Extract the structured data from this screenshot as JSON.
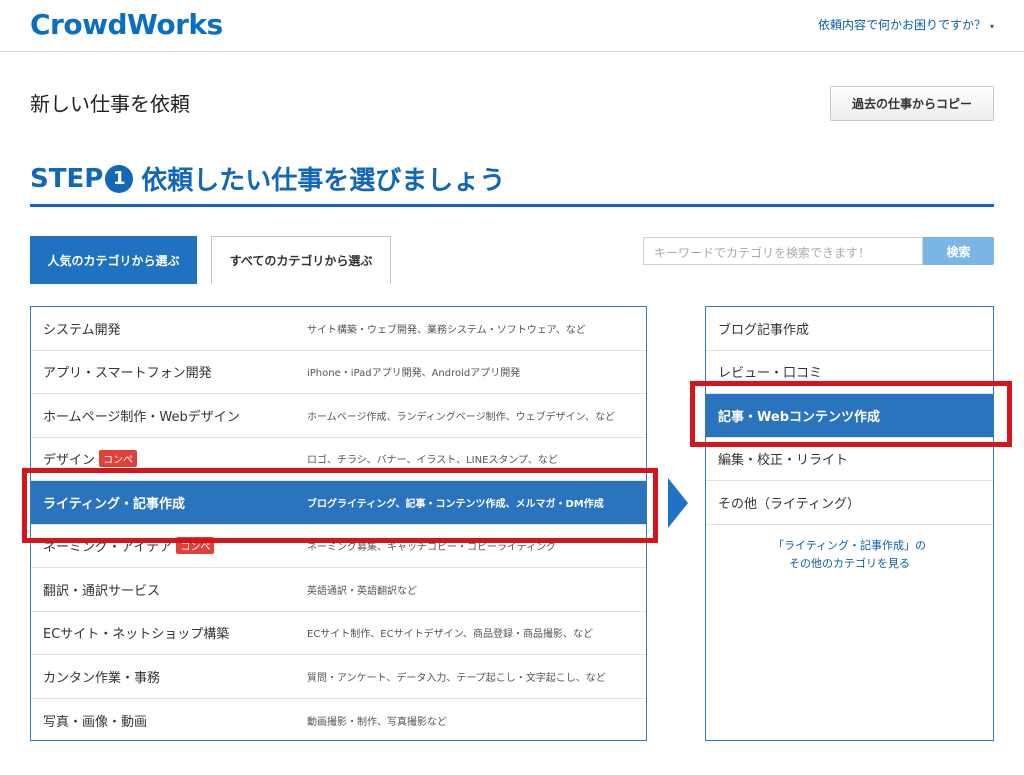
{
  "header": {
    "logo": "CrowdWorks",
    "help_link": "依頼内容で何かお困りですか？",
    "help_caret": "▾"
  },
  "page": {
    "title": "新しい仕事を依頼",
    "copy_button": "過去の仕事からコピー"
  },
  "step": {
    "prefix": "STEP",
    "number": "1",
    "title": "依頼したい仕事を選びましょう"
  },
  "tabs": {
    "popular": "人気のカテゴリから選ぶ",
    "all": "すべてのカテゴリから選ぶ"
  },
  "search": {
    "placeholder": "キーワードでカテゴリを検索できます！",
    "button": "検索"
  },
  "categories": [
    {
      "name": "システム開発",
      "desc": "サイト構築・ウェブ開発、業務システム・ソフトウェア、など",
      "badge": ""
    },
    {
      "name": "アプリ・スマートフォン開発",
      "desc": "iPhone・iPadアプリ開発、Androidアプリ開発",
      "badge": ""
    },
    {
      "name": "ホームページ制作・Webデザイン",
      "desc": "ホームページ作成、ランディングページ制作、ウェブデザイン、など",
      "badge": ""
    },
    {
      "name": "デザイン",
      "desc": "ロゴ、チラシ、バナー、イラスト、LINEスタンプ、など",
      "badge": "コンペ"
    },
    {
      "name": "ライティング・記事作成",
      "desc": "ブログライティング、記事・コンテンツ作成、メルマガ・DM作成",
      "badge": ""
    },
    {
      "name": "ネーミング・アイデア",
      "desc": "ネーミング募集、キャッチコピー・コピーライティング",
      "badge": "コンペ"
    },
    {
      "name": "翻訳・通訳サービス",
      "desc": "英語通訳・英語翻訳など",
      "badge": ""
    },
    {
      "name": "ECサイト・ネットショップ構築",
      "desc": "ECサイト制作、ECサイトデザイン、商品登録・商品撮影、など",
      "badge": ""
    },
    {
      "name": "カンタン作業・事務",
      "desc": "質問・アンケート、データ入力、テープ起こし・文字起こし、など",
      "badge": ""
    },
    {
      "name": "写真・画像・動画",
      "desc": "動画撮影・制作、写真撮影など",
      "badge": ""
    }
  ],
  "subcategories": [
    {
      "name": "ブログ記事作成"
    },
    {
      "name": "レビュー・口コミ"
    },
    {
      "name": "記事・Webコンテンツ作成"
    },
    {
      "name": "編集・校正・リライト"
    },
    {
      "name": "その他（ライティング）"
    }
  ],
  "sub_more": {
    "line1": "「ライティング・記事作成」の",
    "line2": "その他のカテゴリを見る"
  },
  "colors": {
    "brand": "#0b6fc1",
    "selected": "#2a73bd",
    "badge": "#e0413a",
    "highlight": "#d5141b"
  }
}
